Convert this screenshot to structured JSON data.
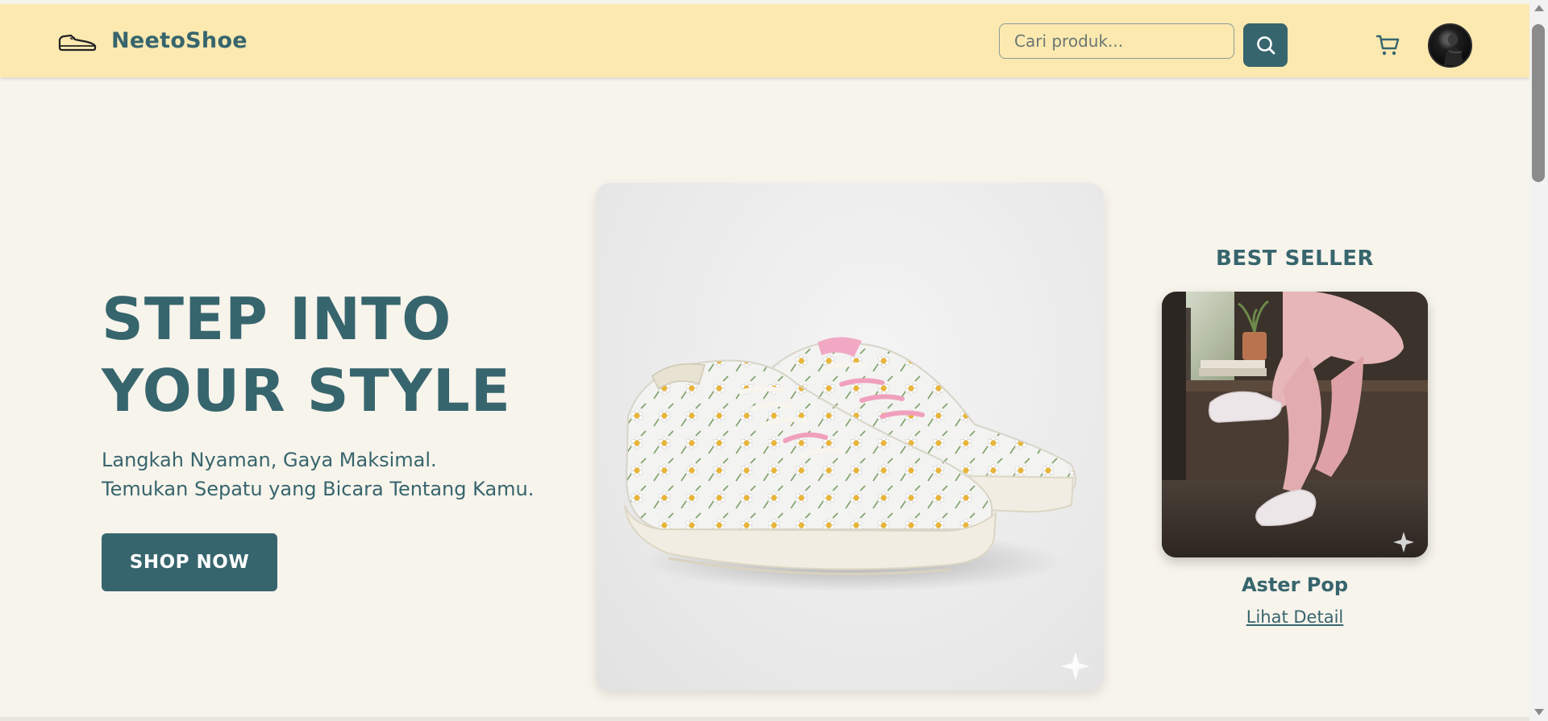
{
  "header": {
    "brand": "NeetoShoe",
    "search_placeholder": "Cari produk...",
    "icons": {
      "logo": "sneaker-outline-icon",
      "search": "search-icon",
      "cart": "cart-icon",
      "avatar": "user-avatar"
    }
  },
  "hero": {
    "title_line1": "STEP INTO",
    "title_line2": "YOUR STYLE",
    "subtitle_line1": "Langkah Nyaman, Gaya Maksimal.",
    "subtitle_line2": "Temukan Sepatu yang Bicara Tentang Kamu.",
    "cta": "SHOP NOW"
  },
  "best_seller": {
    "heading": "BEST SELLER",
    "product_name": "Aster Pop",
    "link": "Lihat Detail"
  },
  "colors": {
    "primary": "#37656d",
    "header_bg": "#fbe9b0",
    "page_bg": "#f7f4ec"
  }
}
